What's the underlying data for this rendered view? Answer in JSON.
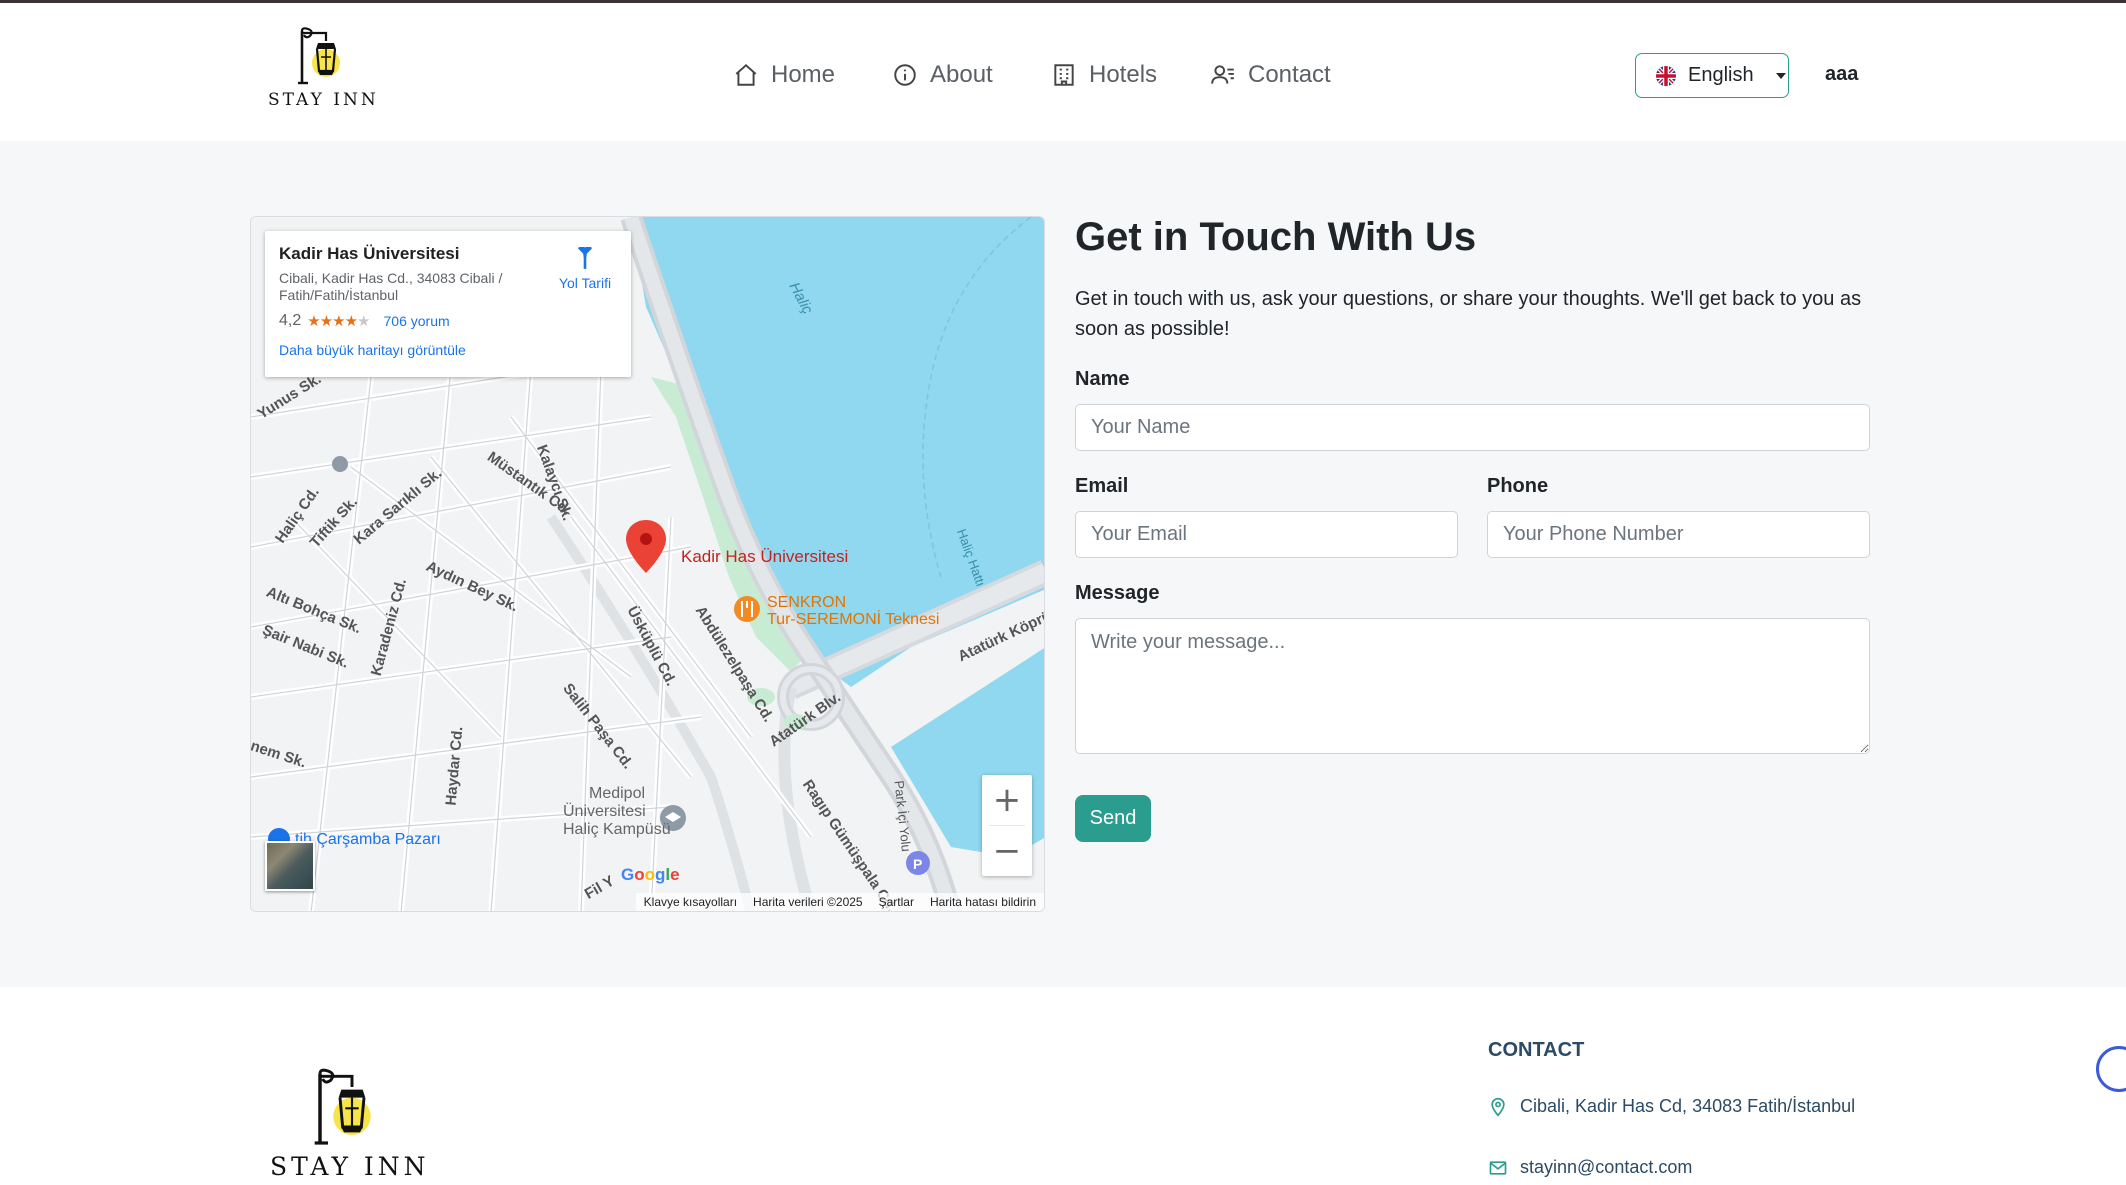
{
  "header": {
    "brand": "STAY INN",
    "nav": [
      {
        "label": "Home",
        "icon": "home-icon"
      },
      {
        "label": "About",
        "icon": "info-icon"
      },
      {
        "label": "Hotels",
        "icon": "building-icon"
      },
      {
        "label": "Contact",
        "icon": "contact-icon"
      }
    ],
    "language": {
      "label": "English",
      "icon": "uk-flag-icon"
    },
    "user": "aaa"
  },
  "map": {
    "place_title": "Kadir Has Üniversitesi",
    "place_address": "Cibali, Kadir Has Cd., 34083 Cibali / Fatih/Fatih/İstanbul",
    "rating": "4,2",
    "rating_value": 4.2,
    "reviews": "706 yorum",
    "bigger_map": "Daha büyük haritayı görüntüle",
    "directions": "Yol Tarifi",
    "zoom_in": "+",
    "zoom_out": "−",
    "google": "Google",
    "footer": [
      "Klavye kısayolları",
      "Harita verileri ©2025",
      "Şartlar",
      "Harita hatası bildirin"
    ],
    "labels": {
      "pin": "Kadir Has Üniversitesi",
      "senkron1": "SENKRON",
      "senkron2": "Tur-SEREMONİ Teknesi",
      "halic": "Haliç",
      "halic_hatti": "Haliç Hattı",
      "ataturk_koprusu": "Atatürk Köprü",
      "ataturk_blv": "Atatürk Blv.",
      "abdulezelpasa": "Abdülezelpaşa Cd.",
      "uskuplu": "Üsküplü Cd.",
      "salih_pasa": "Salih Paşa Cd.",
      "ragip": "Ragıp Gümüşpala Cd.",
      "park_ici": "Park İçi Yolu",
      "mustantik": "Müstantık Cd.",
      "kalayci": "Kalaycı Sk.",
      "kara_sarikli": "Kara Sarıklı Sk.",
      "tiftik": "Tiftik Sk.",
      "halic_cd": "Haliç Cd.",
      "aydin_bey": "Aydın Bey Sk.",
      "alti_bohca": "Altı Bohça Sk.",
      "sair_nabi": "Şair Nabi Sk.",
      "karadeniz": "Karadeniz Cd.",
      "yunus": "Yunus Sk.",
      "haydar": "Haydar Cd.",
      "medipol1": "Medipol",
      "medipol2": "Üniversitesi",
      "medipol3": "Haliç Kampüsü",
      "carsamba": "tih Çarşamba Pazarı",
      "nem": "nem Sk.",
      "fil": "Fil Y"
    }
  },
  "form": {
    "title": "Get in Touch With Us",
    "description": "Get in touch with us, ask your questions, or share your thoughts. We'll get back to you as soon as possible!",
    "name_label": "Name",
    "name_placeholder": "Your Name",
    "email_label": "Email",
    "email_placeholder": "Your Email",
    "phone_label": "Phone",
    "phone_placeholder": "Your Phone Number",
    "message_label": "Message",
    "message_placeholder": "Write your message...",
    "send": "Send"
  },
  "footer": {
    "brand": "STAY INN",
    "contact_heading": "CONTACT",
    "address": "Cibali, Kadir Has Cd, 34083 Fatih/İstanbul",
    "email": "stayinn@contact.com"
  },
  "colors": {
    "accent": "#2a9d8f",
    "water": "#8fd8ef",
    "pin": "#ea4335",
    "footer_text": "#2b4a66"
  }
}
